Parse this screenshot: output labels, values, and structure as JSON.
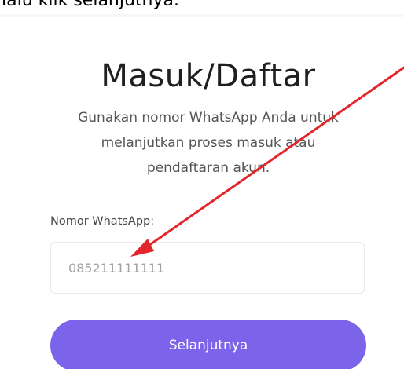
{
  "caption": {
    "text": "lalu klik selanjutnya."
  },
  "form": {
    "title": "Masuk/Daftar",
    "description_lines": [
      "Gunakan nomor WhatsApp Anda untuk",
      "melanjutkan proses masuk atau",
      "pendaftaran akun."
    ],
    "phone_label": "Nomor WhatsApp:",
    "phone_placeholder": "085211111111",
    "submit_label": "Selanjutnya"
  },
  "annotation": {
    "arrow_icon": "red-arrow-icon",
    "arrow_color": "#e3262b"
  },
  "theme": {
    "accent": "#7b63ea",
    "background": "#ffffff"
  }
}
